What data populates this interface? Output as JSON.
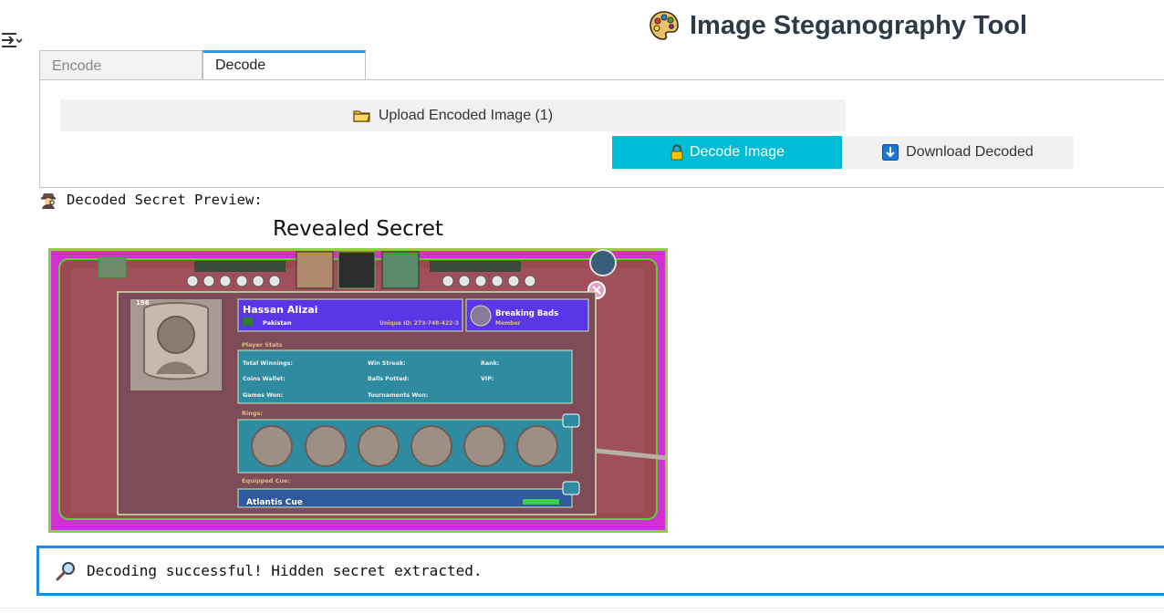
{
  "app": {
    "title": "Image Steganography Tool",
    "accent_color": "#2196f3",
    "palette_icon": "artist-palette-icon"
  },
  "sidebar_toggle": {
    "icon": "collapse-sidebar-icon"
  },
  "tabs": [
    {
      "label": "Encode",
      "active": false
    },
    {
      "label": "Decode",
      "active": true
    }
  ],
  "decode_panel": {
    "upload_button": {
      "label": "Upload Encoded Image (1)",
      "icon": "folder-icon"
    },
    "decode_button": {
      "label": "Decode Image",
      "icon": "lock-icon",
      "color": "#00bcd4"
    },
    "download_button": {
      "label": "Download Decoded",
      "icon": "download-arrow-icon"
    }
  },
  "preview": {
    "label": "Decoded Secret Preview:",
    "icon": "detective-icon",
    "figure_title": "Revealed Secret",
    "image": {
      "player_name": "Hassan Alizai",
      "country": "Pakistan",
      "unique_id": "Unique ID: 273-748-422-3",
      "club_name": "Breaking Bads",
      "club_role": "Member",
      "section_player_stats": "Player Stats",
      "stat_total_winnings": "Total Winnings:",
      "stat_win_streak": "Win Streak:",
      "stat_rank": "Rank:",
      "stat_coins_wallet": "Coins Wallet:",
      "stat_balls_potted": "Balls Potted:",
      "stat_vip": "VIP:",
      "stat_games_won": "Games Won:",
      "stat_tournaments_won": "Tournaments Won:",
      "section_rings": "Rings:",
      "section_equipped_cue": "Equipped Cue:",
      "cue_name": "Atlantis Cue",
      "level_badge": "196"
    }
  },
  "status": {
    "icon": "magnifier-icon",
    "message": "Decoding successful! Hidden secret extracted.",
    "border_color": "#1e88e5"
  }
}
